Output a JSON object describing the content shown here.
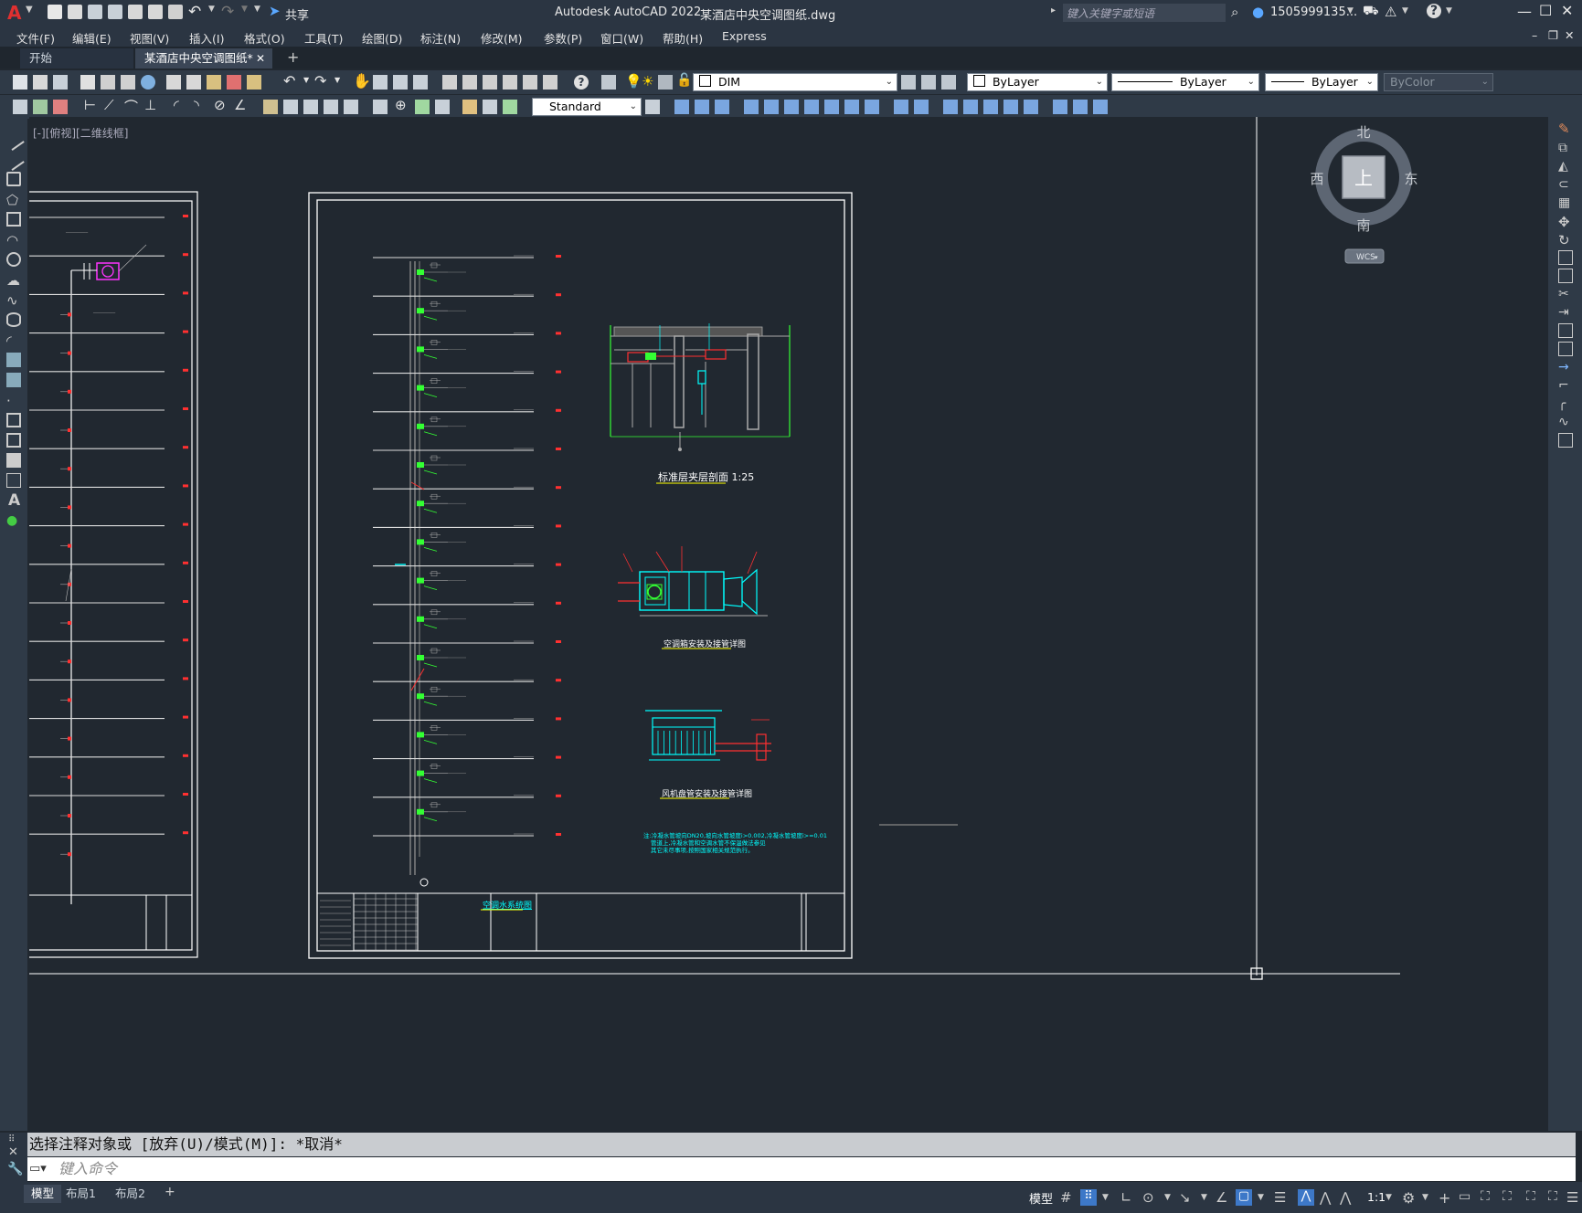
{
  "app": {
    "logo": "A",
    "title": "Autodesk AutoCAD 2022",
    "filename": "某酒店中央空调图纸.dwg",
    "share_label": "共享",
    "search_placeholder": "键入关键字或短语",
    "user": "1505999135...",
    "window_controls": [
      "minimize-icon",
      "maximize-icon",
      "close-icon"
    ]
  },
  "menu": [
    "文件(F)",
    "编辑(E)",
    "视图(V)",
    "插入(I)",
    "格式(O)",
    "工具(T)",
    "绘图(D)",
    "标注(N)",
    "修改(M)",
    "参数(P)",
    "窗口(W)",
    "帮助(H)",
    "Express"
  ],
  "tabs": [
    {
      "label": "开始",
      "active": false
    },
    {
      "label": "某酒店中央空调图纸*",
      "active": true
    }
  ],
  "toolbar": {
    "layer": "DIM",
    "color": "ByLayer",
    "linetype": "ByLayer",
    "lineweight": "ByLayer",
    "plotstyle": "ByColor",
    "text_style": "Standard"
  },
  "viewport": {
    "label": "[-][俯视][二维线框]",
    "viewcube": {
      "north": "北",
      "south": "南",
      "east": "东",
      "west": "西",
      "face": "上",
      "wcs": "WCS"
    }
  },
  "drawing": {
    "detail_title_1": "标准层夹层剖面 1:25",
    "detail_title_2": "空调箱安装及接管详图",
    "detail_title_3": "风机盘管安装及接管详图",
    "riser_title": "空调水系统图",
    "note_line1": "注:冷凝水管坡向DN20,坡向水管坡度i>0.002,冷凝水管坡度i>=0.01",
    "note_line2": "管道上,冷凝水管和空调水管不保温做法参见",
    "note_line3": "其它未尽事项,按照国家相关规范执行。"
  },
  "command": {
    "history": "选择注释对象或 [放弃(U)/模式(M)]: *取消*",
    "placeholder": "键入命令"
  },
  "layout_tabs": [
    "模型",
    "布局1",
    "布局2"
  ],
  "status": {
    "model_label": "模型",
    "scale": "1:1"
  },
  "colors": {
    "background": "#212830",
    "accent_red": "#ff3030",
    "accent_cyan": "#00ffff",
    "accent_green": "#33ff33",
    "accent_magenta": "#ff33ff"
  }
}
